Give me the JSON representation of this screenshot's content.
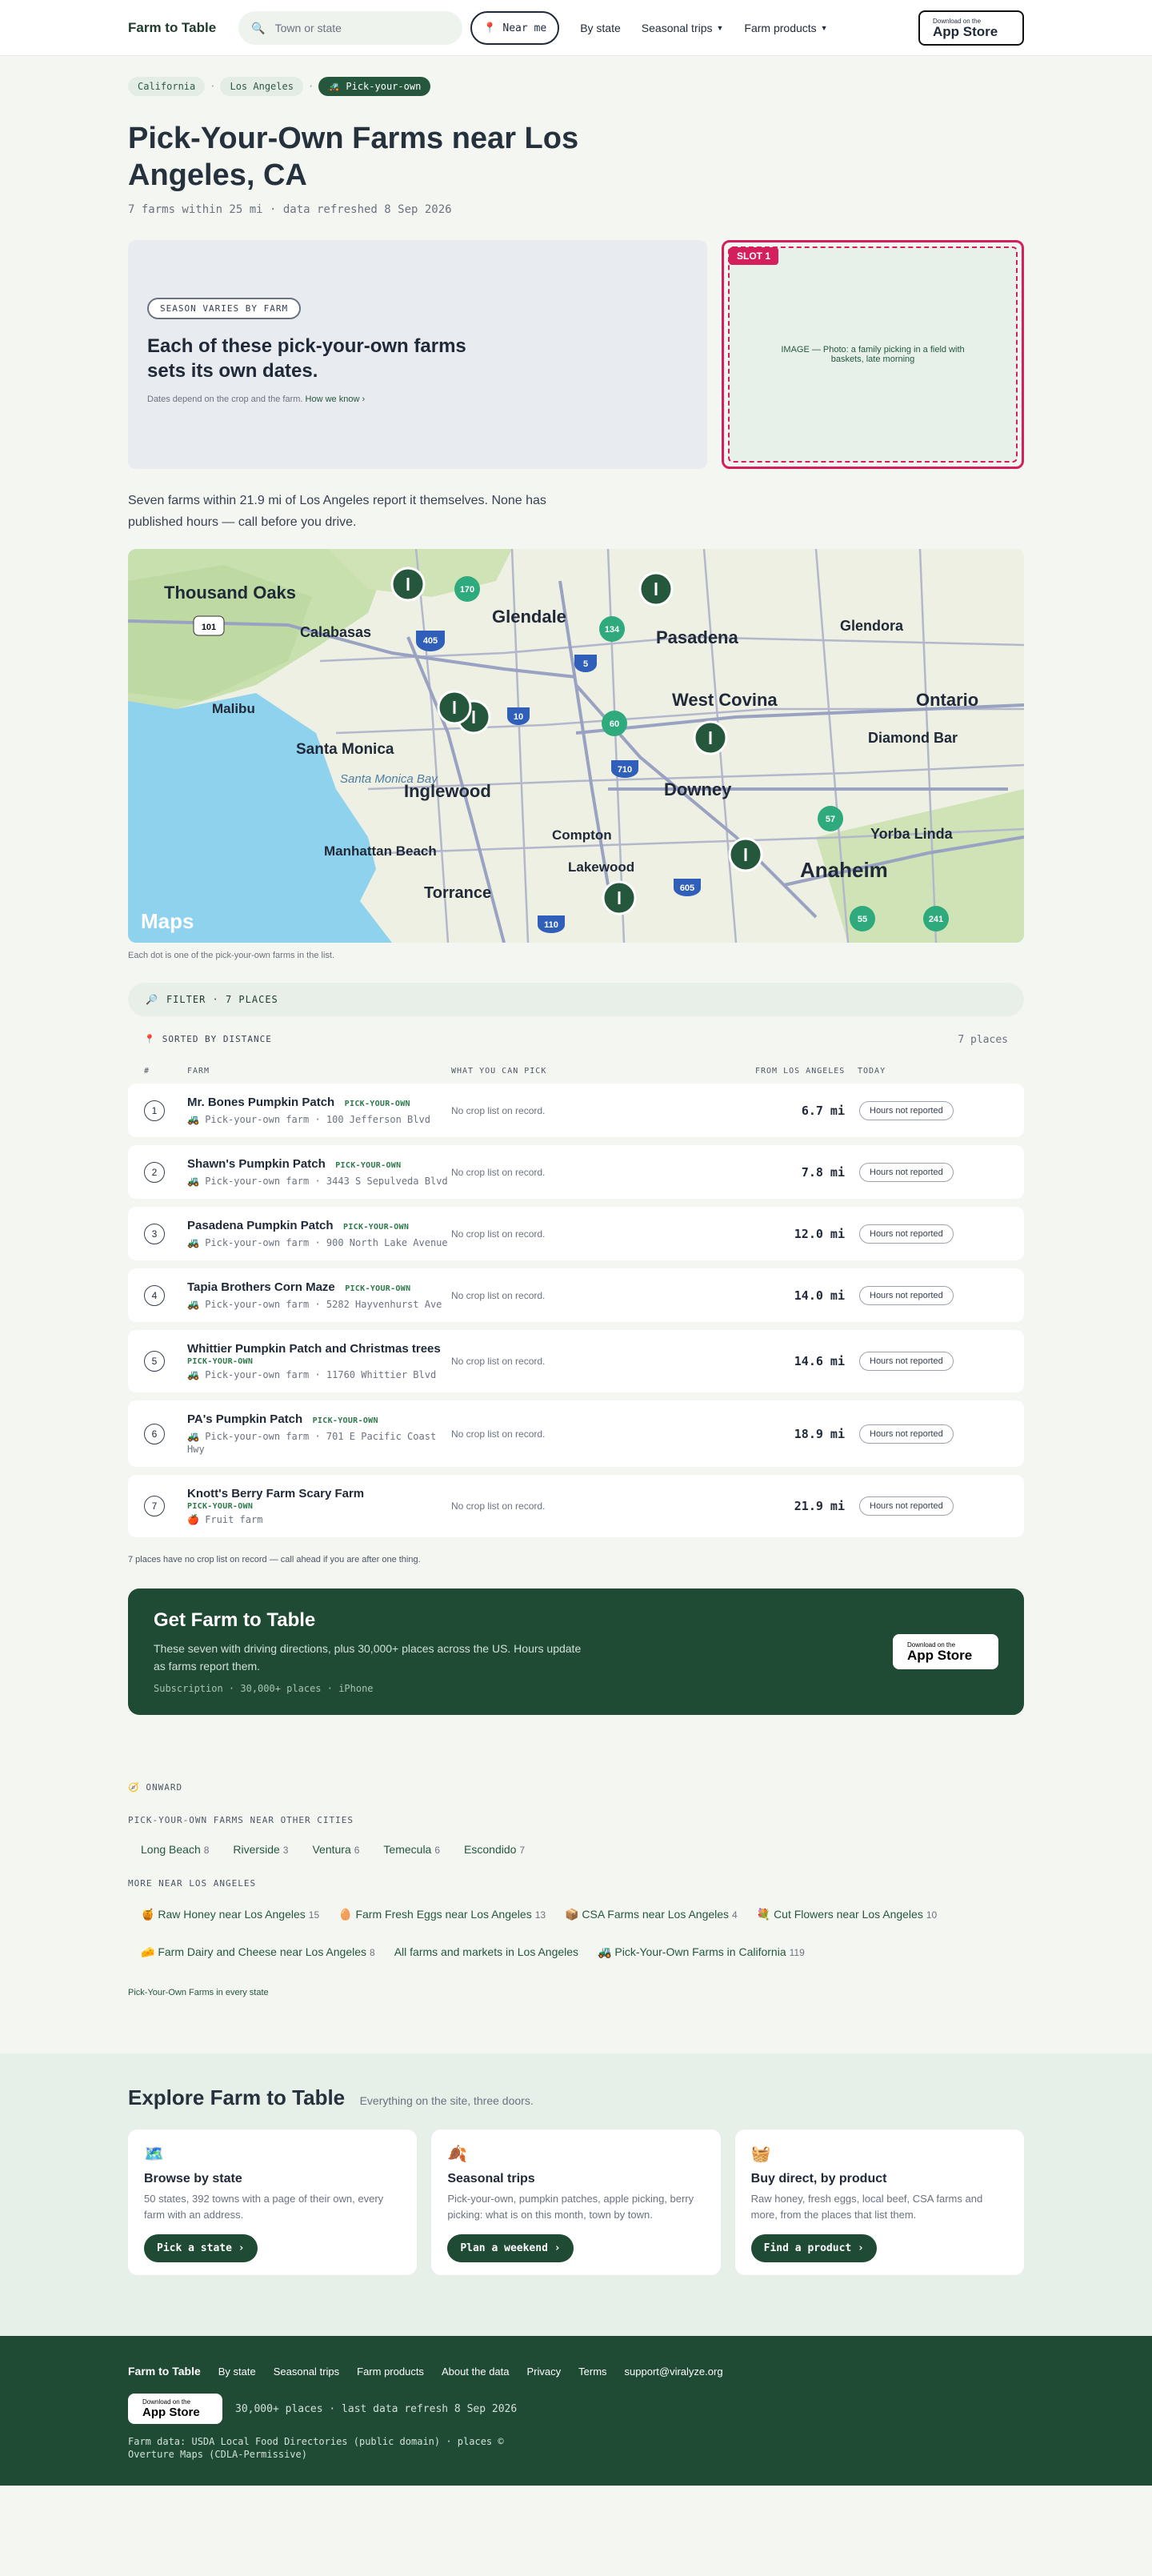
{
  "header": {
    "logo": "Farm to Table",
    "search_placeholder": "Town or state",
    "near_me": "Near me",
    "nav": [
      "By state",
      "Seasonal trips",
      "Farm products"
    ],
    "appstore_small": "Download on the",
    "appstore_big": "App Store"
  },
  "breadcrumb": [
    "California",
    "Los Angeles",
    "Pick-your-own"
  ],
  "page": {
    "title": "Pick-Your-Own Farms near Los Angeles, CA",
    "meta": "7 farms within 25 mi · data refreshed 8 Sep 2026"
  },
  "hero": {
    "pill": "SEASON VARIES BY FARM",
    "heading": "Each of these pick-your-own farms sets its own dates.",
    "note": "Dates depend on the crop and the farm.",
    "link": "How we know ›",
    "slot_tag": "SLOT 1",
    "slot_text": "IMAGE — Photo: a family picking in a field with baskets, late morning"
  },
  "intro": "Seven farms within 21.9 mi of Los Angeles report it themselves. None has published hours — call before you drive.",
  "map": {
    "labels": [
      "Thousand Oaks",
      "Calabasas",
      "Glendale",
      "Pasadena",
      "Glendora",
      "Malibu",
      "Santa Monica",
      "West Covina",
      "Ontario",
      "Diamond Bar",
      "Inglewood",
      "Downey",
      "Santa Monica Bay",
      "Compton",
      "Yorba Linda",
      "Manhattan Beach",
      "Lakewood",
      "Anaheim",
      "Torrance"
    ],
    "shields": [
      "101",
      "170",
      "405",
      "134",
      "5",
      "10",
      "60",
      "710",
      "57",
      "605",
      "110",
      "55",
      "241"
    ],
    "brand": "Maps",
    "note": "Each dot is one of the pick-your-own farms in the list."
  },
  "filter": "FILTER · 7 PLACES",
  "sorted": {
    "label": "SORTED BY DISTANCE",
    "count": "7 places"
  },
  "columns": [
    "#",
    "FARM",
    "WHAT YOU CAN PICK",
    "FROM LOS ANGELES",
    "TODAY"
  ],
  "farms": [
    {
      "n": "1",
      "name": "Mr. Bones Pumpkin Patch",
      "badge": "PICK-YOUR-OWN",
      "icon": "🚜",
      "sub": "Pick-your-own farm · 100 Jefferson Blvd",
      "pick": "No crop list on record.",
      "dist": "6.7 mi",
      "today": "Hours not reported"
    },
    {
      "n": "2",
      "name": "Shawn's Pumpkin Patch",
      "badge": "PICK-YOUR-OWN",
      "icon": "🚜",
      "sub": "Pick-your-own farm · 3443 S Sepulveda Blvd",
      "pick": "No crop list on record.",
      "dist": "7.8 mi",
      "today": "Hours not reported"
    },
    {
      "n": "3",
      "name": "Pasadena Pumpkin Patch",
      "badge": "PICK-YOUR-OWN",
      "icon": "🚜",
      "sub": "Pick-your-own farm · 900 North Lake Avenue",
      "pick": "No crop list on record.",
      "dist": "12.0 mi",
      "today": "Hours not reported"
    },
    {
      "n": "4",
      "name": "Tapia Brothers Corn Maze",
      "badge": "PICK-YOUR-OWN",
      "icon": "🚜",
      "sub": "Pick-your-own farm · 5282 Hayvenhurst Ave",
      "pick": "No crop list on record.",
      "dist": "14.0 mi",
      "today": "Hours not reported"
    },
    {
      "n": "5",
      "name": "Whittier Pumpkin Patch and Christmas trees",
      "badge": "PICK-YOUR-OWN",
      "icon": "🚜",
      "sub": "Pick-your-own farm · 11760 Whittier Blvd",
      "pick": "No crop list on record.",
      "dist": "14.6 mi",
      "today": "Hours not reported"
    },
    {
      "n": "6",
      "name": "PA's Pumpkin Patch",
      "badge": "PICK-YOUR-OWN",
      "icon": "🚜",
      "sub": "Pick-your-own farm · 701 E Pacific Coast Hwy",
      "pick": "No crop list on record.",
      "dist": "18.9 mi",
      "today": "Hours not reported"
    },
    {
      "n": "7",
      "name": "Knott's Berry Farm Scary Farm",
      "badge": "PICK-YOUR-OWN",
      "icon": "🍎",
      "sub": "Fruit farm",
      "pick": "No crop list on record.",
      "dist": "21.9 mi",
      "today": "Hours not reported"
    }
  ],
  "table_note": "7 places have no crop list on record — call ahead if you are after one thing.",
  "cta": {
    "title": "Get Farm to Table",
    "text": "These seven with driving directions, plus 30,000+ places across the US. Hours update as farms report them.",
    "meta": "Subscription · 30,000+ places · iPhone"
  },
  "onward": {
    "label": "ONWARD",
    "cities_label": "PICK-YOUR-OWN FARMS NEAR OTHER CITIES",
    "cities": [
      {
        "name": "Long Beach",
        "count": "8"
      },
      {
        "name": "Riverside",
        "count": "3"
      },
      {
        "name": "Ventura",
        "count": "6"
      },
      {
        "name": "Temecula",
        "count": "6"
      },
      {
        "name": "Escondido",
        "count": "7"
      }
    ],
    "more_label": "MORE NEAR LOS ANGELES",
    "more": [
      {
        "icon": "🍯",
        "name": "Raw Honey near Los Angeles",
        "count": "15"
      },
      {
        "icon": "🥚",
        "name": "Farm Fresh Eggs near Los Angeles",
        "count": "13"
      },
      {
        "icon": "📦",
        "name": "CSA Farms near Los Angeles",
        "count": "4"
      },
      {
        "icon": "💐",
        "name": "Cut Flowers near Los Angeles",
        "count": "10"
      },
      {
        "icon": "🧀",
        "name": "Farm Dairy and Cheese near Los Angeles",
        "count": "8"
      },
      {
        "icon": "",
        "name": "All farms and markets in Los Angeles",
        "count": ""
      },
      {
        "icon": "🚜",
        "name": "Pick-Your-Own Farms in California",
        "count": "119"
      }
    ],
    "every_state": "Pick-Your-Own Farms in every state"
  },
  "explore": {
    "title": "Explore Farm to Table",
    "tagline": "Everything on the site, three doors.",
    "cards": [
      {
        "icon": "🗺️",
        "title": "Browse by state",
        "text": "50 states, 392 towns with a page of their own, every farm with an address.",
        "button": "Pick a state ›"
      },
      {
        "icon": "🍂",
        "title": "Seasonal trips",
        "text": "Pick-your-own, pumpkin patches, apple picking, berry picking: what is on this month, town by town.",
        "button": "Plan a weekend ›"
      },
      {
        "icon": "🧺",
        "title": "Buy direct, by product",
        "text": "Raw honey, fresh eggs, local beef, CSA farms and more, from the places that list them.",
        "button": "Find a product ›"
      }
    ]
  },
  "footer": {
    "logo": "Farm to Table",
    "links": [
      "By state",
      "Seasonal trips",
      "Farm products",
      "About the data",
      "Privacy",
      "Terms",
      "support@viralyze.org"
    ],
    "meta": "30,000+ places · last data refresh 8 Sep 2026",
    "data": "Farm data: USDA Local Food Directories (public domain) · places © Overture Maps (CDLA-Permissive)"
  }
}
